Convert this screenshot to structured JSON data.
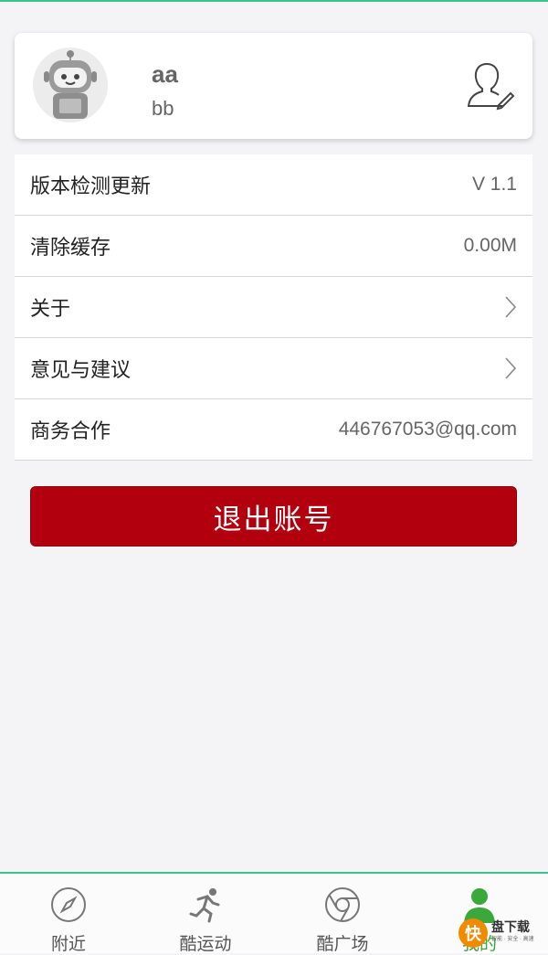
{
  "profile": {
    "name": "aa",
    "subtitle": "bb",
    "avatar_icon": "robot-avatar-icon",
    "edit_icon": "user-edit-icon"
  },
  "settings": {
    "rows": [
      {
        "label": "版本检测更新",
        "value": "V 1.1"
      },
      {
        "label": "清除缓存",
        "value": "0.00M"
      },
      {
        "label": "关于",
        "value": ""
      },
      {
        "label": "意见与建议",
        "value": ""
      },
      {
        "label": "商务合作",
        "value": "446767053@qq.com"
      }
    ]
  },
  "logout": {
    "label": "退出账号"
  },
  "tabs": [
    {
      "label": "附近",
      "icon": "compass-icon"
    },
    {
      "label": "酷运动",
      "icon": "runner-icon"
    },
    {
      "label": "酷广场",
      "icon": "chrome-circle-icon"
    },
    {
      "label": "我的",
      "icon": "person-icon",
      "active": true
    }
  ],
  "watermark": {
    "badge": "快",
    "title": "盘下载",
    "small": "智能 · 安全 · 高速"
  },
  "colors": {
    "accent": "#37c48f",
    "logout": "#b3000e",
    "active_tab": "#3aa83a"
  }
}
